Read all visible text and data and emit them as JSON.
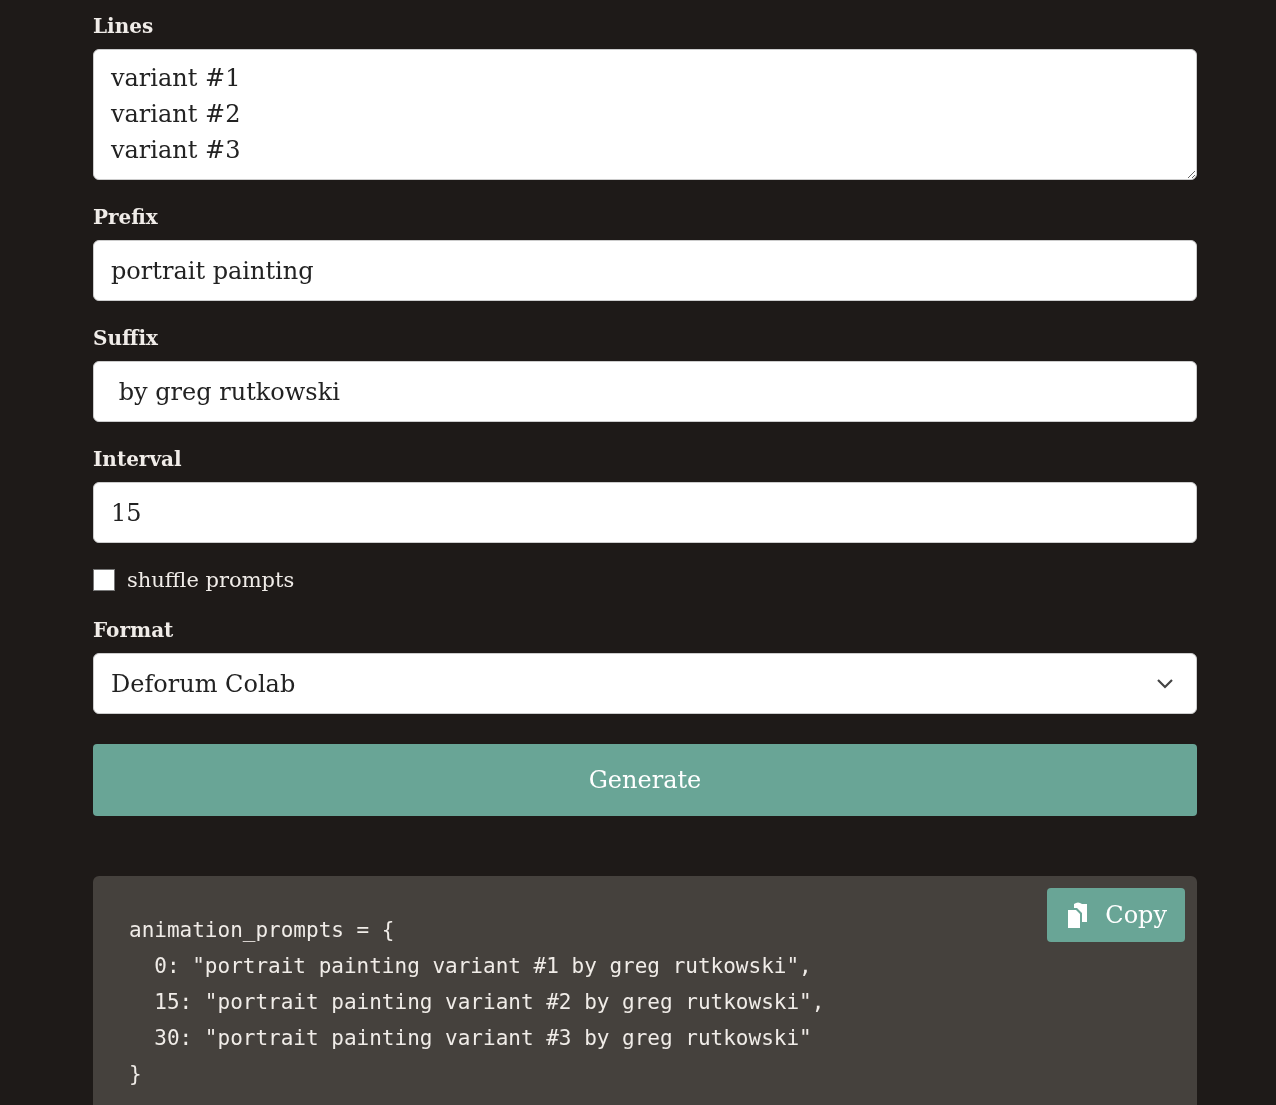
{
  "form": {
    "fields": [
      {
        "kind": "textarea",
        "label": "Lines",
        "value": "variant #1\nvariant #2\nvariant #3"
      },
      {
        "kind": "text",
        "label": "Prefix",
        "value": "portrait painting"
      },
      {
        "kind": "text",
        "label": "Suffix",
        "value": " by greg rutkowski"
      },
      {
        "kind": "text",
        "label": "Interval",
        "value": "15"
      },
      {
        "kind": "checkbox",
        "label": "shuffle prompts",
        "checked": false
      },
      {
        "kind": "select",
        "label": "Format",
        "value": "Deforum Colab"
      }
    ],
    "generate_button": "Generate"
  },
  "output": {
    "copy_button": "Copy",
    "code_lines": [
      "animation_prompts = {",
      "  0: \"portrait painting variant #1 by greg rutkowski\",",
      "  15: \"portrait painting variant #2 by greg rutkowski\",",
      "  30: \"portrait painting variant #3 by greg rutkowski\"",
      "}"
    ]
  }
}
